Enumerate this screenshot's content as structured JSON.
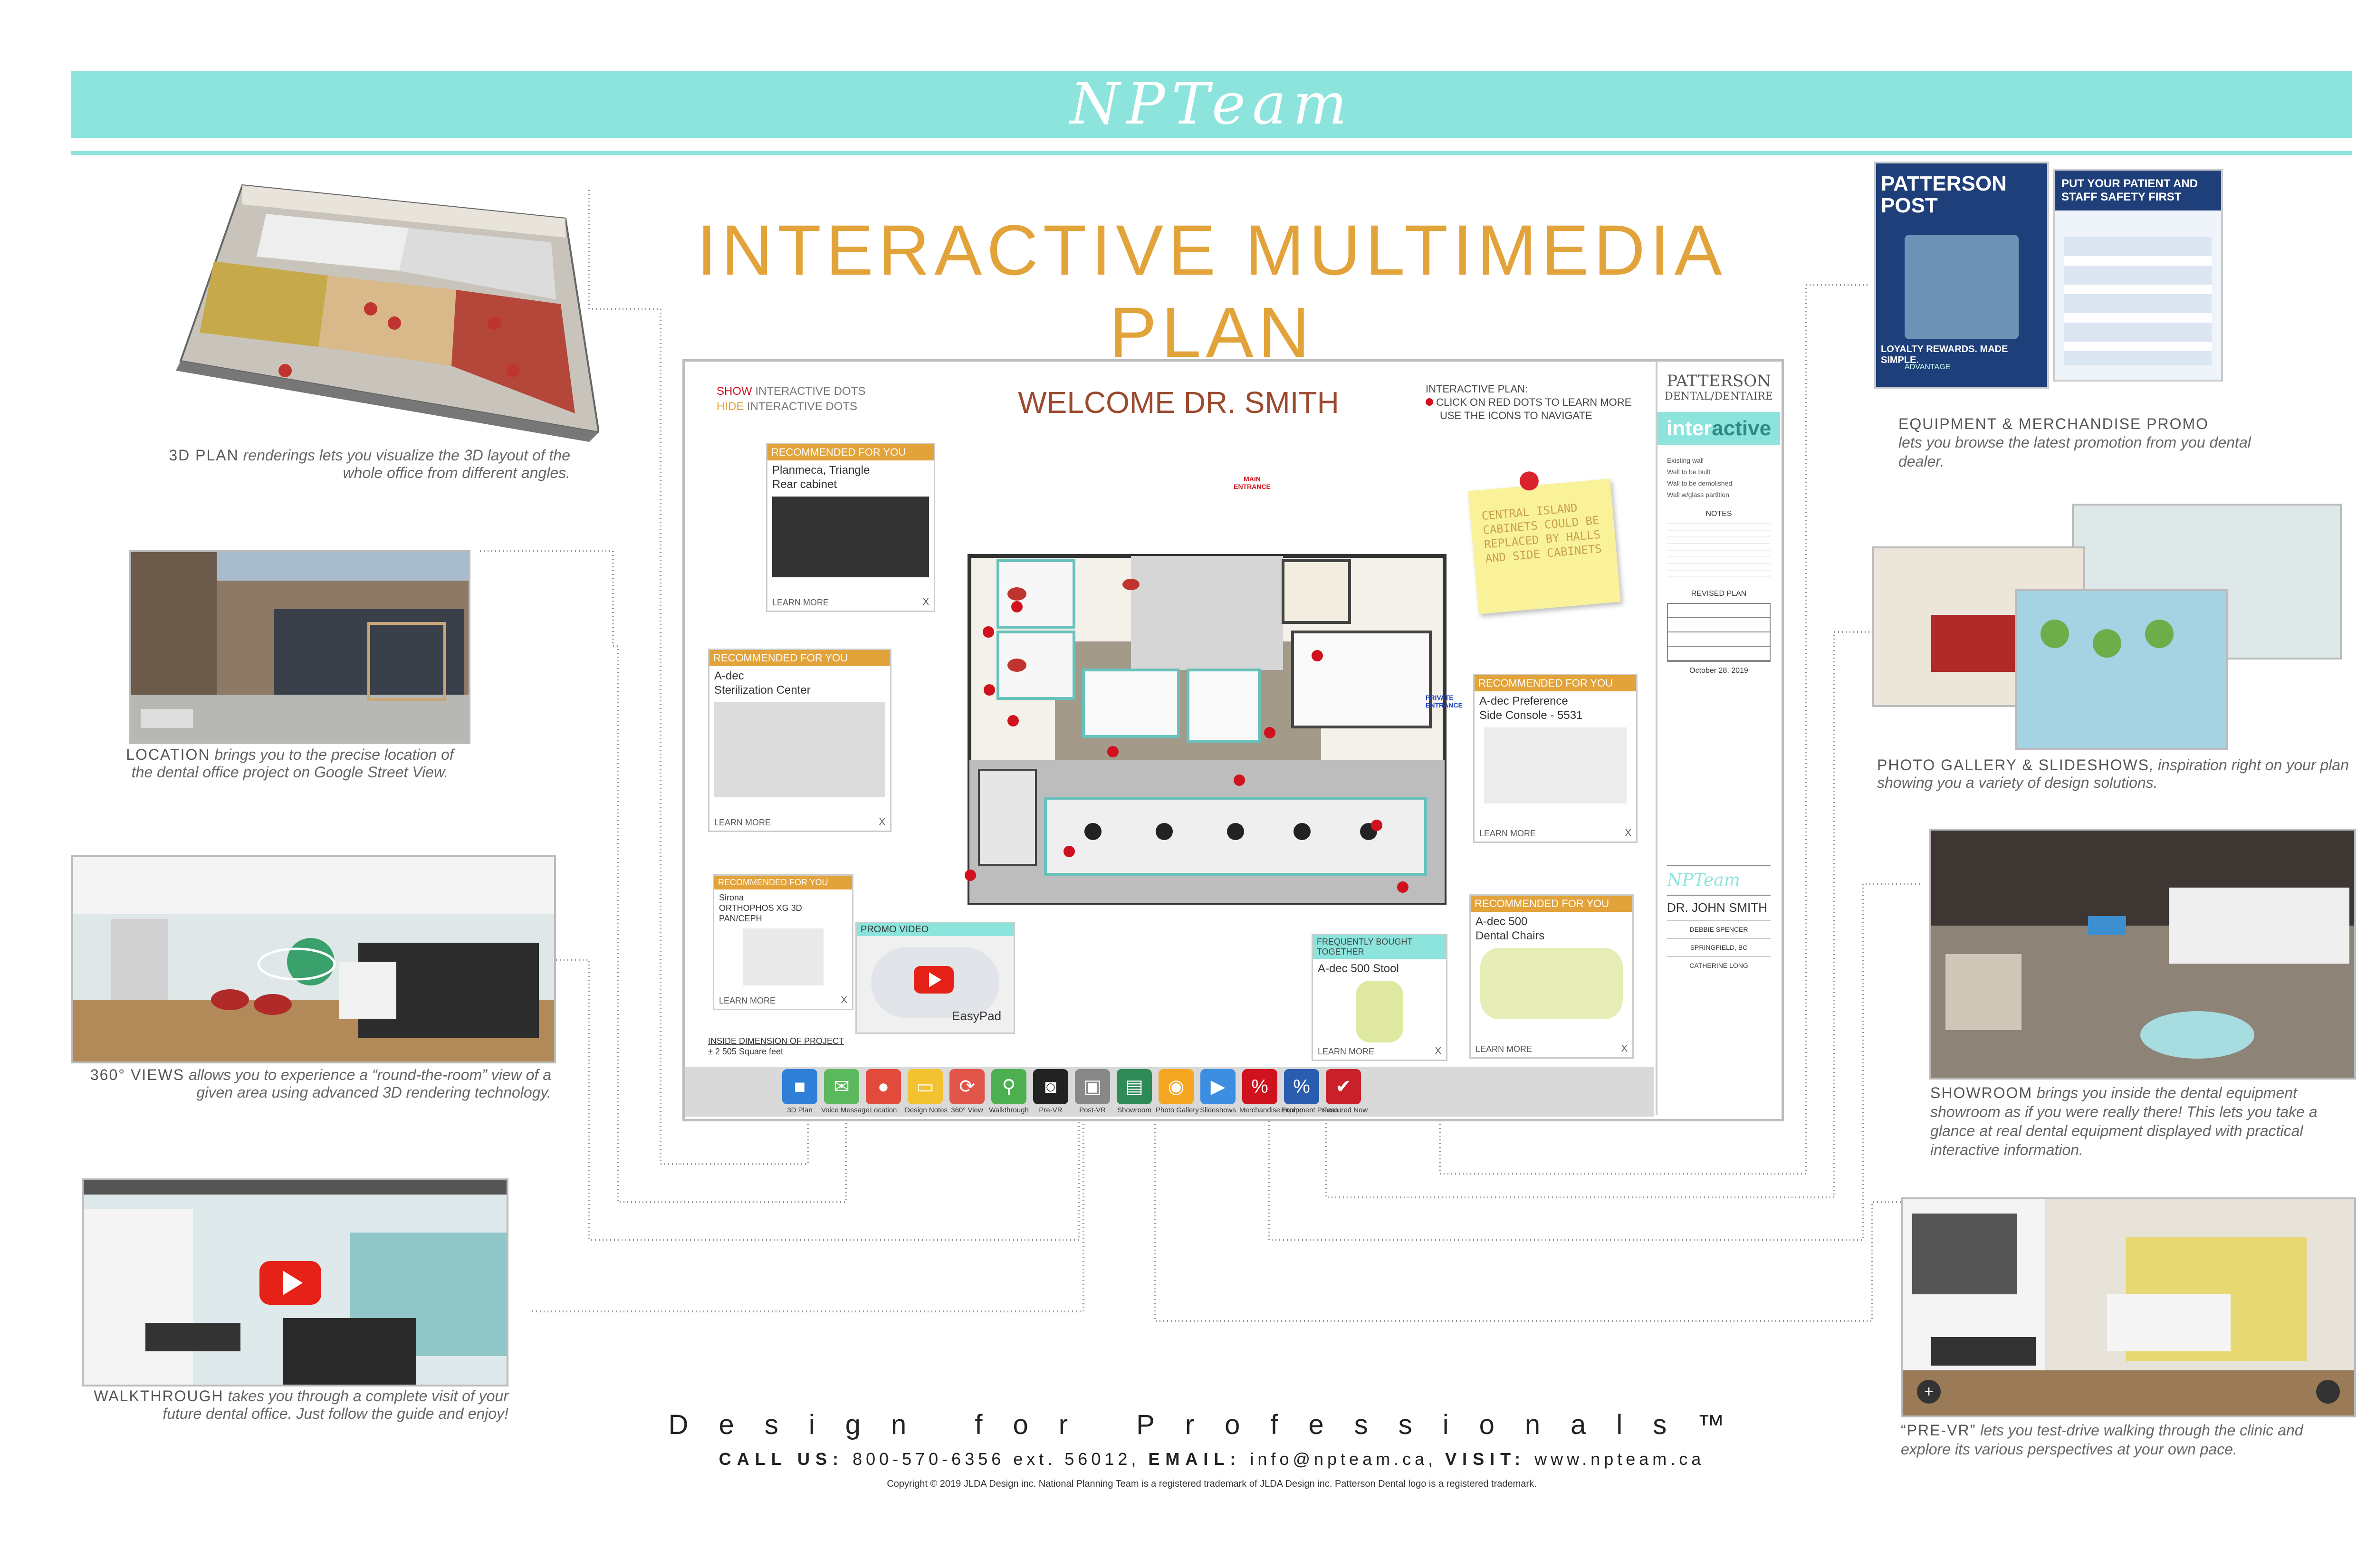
{
  "brand": {
    "logo_text": "NPTeam",
    "accent": "#8de4dc",
    "title_color": "#e2a33a"
  },
  "title": "INTERACTIVE MULTIMEDIA PLAN",
  "features": {
    "plan3d": {
      "title": "3D PLAN",
      "desc": "renderings lets you visualize the 3D layout of the whole office from different angles."
    },
    "location": {
      "title": "LOCATION",
      "desc": "brings you to the precise location of the dental office project on Google Street View."
    },
    "views360": {
      "title": "360° VIEWS",
      "desc": "allows you to experience a “round-the-room” view of a given area using advanced 3D rendering technology."
    },
    "walkthrough": {
      "title": "WALKTHROUGH",
      "desc": "takes you through a complete visit of your future dental office. Just follow the guide and enjoy!"
    },
    "equipment": {
      "title": "EQUIPMENT & MERCHANDISE PROMO",
      "desc": "lets you browse the latest promotion from you dental dealer."
    },
    "gallery": {
      "title": "PHOTO GALLERY & SLIDESHOWS",
      "desc": ", inspiration right on your plan showing you a variety of design solutions."
    },
    "showroom": {
      "title": "SHOWROOM",
      "desc": "brings you inside the dental equipment showroom as if you were really there! This lets you take a glance at real dental equipment displayed with practical interactive information."
    },
    "prevr": {
      "title": "“PRE-VR”",
      "desc": "lets you test-drive walking through the clinic and explore its various perspectives at your own pace."
    }
  },
  "patterson_post": {
    "title": "PATTERSON POST",
    "headline": "PUT YOUR PATIENT AND STAFF SAFETY FIRST",
    "tagline": "LOYALTY REWARDS. MADE SIMPLE.",
    "advantage": "ADVANTAGE"
  },
  "plan": {
    "show_dots": "SHOW",
    "hide_dots": "HIDE",
    "dots_suffix": "INTERACTIVE DOTS",
    "welcome": "WELCOME DR. SMITH",
    "instructions_title": "INTERACTIVE PLAN:",
    "instructions_1": "CLICK ON RED DOTS TO LEARN MORE",
    "instructions_2": "USE THE ICONS TO NAVIGATE",
    "main_entrance": "MAIN ENTRANCE",
    "private_entrance": "PRIVATE ENTRANCE",
    "sticky_note": "CENTRAL ISLAND CABINETS COULD BE REPLACED BY HALLS AND SIDE CABINETS",
    "inside_dim_label": "INSIDE DIMENSION OF PROJECT",
    "inside_dim_value": "± 2 505 Square feet",
    "promo_video_label": "PROMO VIDEO",
    "promo_video_product": "EasyPad"
  },
  "cards": [
    {
      "header": "RECOMMENDED FOR YOU",
      "line1": "Planmeca, Triangle",
      "line2": "Rear cabinet",
      "learn": "LEARN MORE",
      "close": "X"
    },
    {
      "header": "RECOMMENDED FOR YOU",
      "line1": "A-dec",
      "line2": "Sterilization Center",
      "learn": "LEARN MORE",
      "close": "X"
    },
    {
      "header": "RECOMMENDED FOR YOU",
      "line1": "Sirona",
      "line2": "ORTHOPHOS XG 3D PAN/CEPH",
      "learn": "LEARN MORE",
      "close": "X"
    },
    {
      "header": "RECOMMENDED FOR YOU",
      "line1": "A-dec Preference",
      "line2": "Side Console - 5531",
      "learn": "LEARN MORE",
      "close": "X"
    },
    {
      "header": "RECOMMENDED FOR YOU",
      "line1": "A-dec 500",
      "line2": "Dental Chairs",
      "learn": "LEARN MORE",
      "close": "X"
    },
    {
      "header": "FREQUENTLY BOUGHT TOGETHER",
      "line1": "A-dec 500 Stool",
      "line2": "",
      "learn": "LEARN MORE",
      "close": "X"
    }
  ],
  "sidebar": {
    "brand_line1": "PATTERSON",
    "brand_line2": "DENTAL/DENTAIRE",
    "banner_a": "inter",
    "banner_b": "active",
    "legend": [
      "Existing wall",
      "Wall to be built",
      "Wall to be demolished",
      "Wall w/glass partition"
    ],
    "notes_label": "NOTES",
    "revised_label": "REVISED PLAN",
    "date": "October 28, 2019",
    "logo": "NPTeam",
    "doctor": "DR. JOHN SMITH",
    "rep": "DEBBIE SPENCER",
    "city": "SPRINGFIELD, BC",
    "designer": "CATHERINE LONG"
  },
  "toolbar": [
    {
      "label": "3D Plan",
      "icon": "cube-icon",
      "color": "#2f7fd8"
    },
    {
      "label": "Voice Message",
      "icon": "envelope-icon",
      "color": "#5cb85c"
    },
    {
      "label": "Location",
      "icon": "map-pin-icon",
      "color": "#e24a3b"
    },
    {
      "label": "Design Notes",
      "icon": "note-icon",
      "color": "#f2c230"
    },
    {
      "label": "360° View",
      "icon": "view360-icon",
      "color": "#e2554a"
    },
    {
      "label": "Walkthrough",
      "icon": "walk-icon",
      "color": "#4caf50"
    },
    {
      "label": "Pre-VR",
      "icon": "vr-headset-icon",
      "color": "#222222"
    },
    {
      "label": "Post-VR",
      "icon": "vr-frame-icon",
      "color": "#888888"
    },
    {
      "label": "Showroom",
      "icon": "easel-icon",
      "color": "#2e8b57"
    },
    {
      "label": "Photo Gallery",
      "icon": "camera-icon",
      "color": "#f5a623"
    },
    {
      "label": "Slideshows",
      "icon": "slideshow-icon",
      "color": "#3b8ee0"
    },
    {
      "label": "Merchandise Promo",
      "icon": "promo-tag-icon",
      "color": "#d0121e"
    },
    {
      "label": "Equipment Promo",
      "icon": "percent-tag-icon",
      "color": "#2a5db0"
    },
    {
      "label": "Featured Now",
      "icon": "checkmark-icon",
      "color": "#c9202a"
    }
  ],
  "footer": {
    "tagline": "Design for Professionals™",
    "call_label": "CALL US:",
    "phone": "800-570-6356 ext. 56012,",
    "email_label": "EMAIL:",
    "email": "info@npteam.ca,",
    "visit_label": "VISIT:",
    "website": "www.npteam.ca",
    "copyright": "Copyright © 2019 JLDA Design inc. National Planning Team is a registered trademark of JLDA Design inc. Patterson Dental logo is a registered trademark."
  }
}
